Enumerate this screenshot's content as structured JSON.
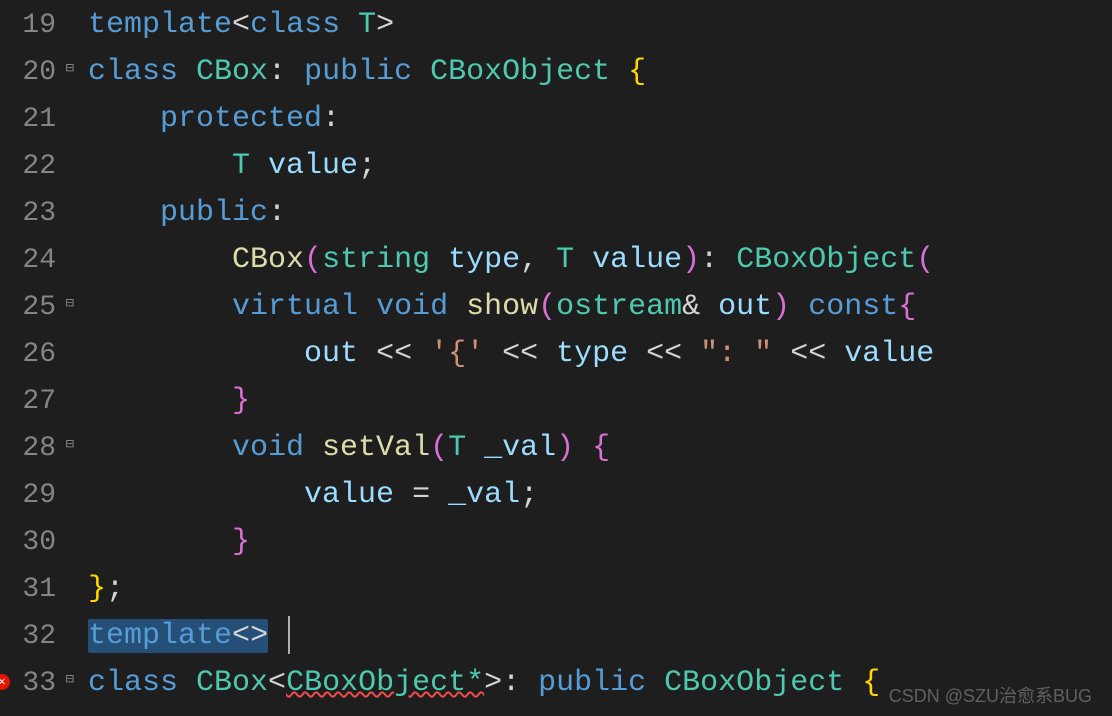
{
  "gutter": {
    "start": 19,
    "end": 33,
    "fold_lines": [
      20,
      25,
      28,
      33
    ],
    "error_lines": [
      33
    ]
  },
  "code": {
    "l19": {
      "template": "template",
      "lt": "<",
      "class": "class",
      "T": " T",
      "gt": ">"
    },
    "l20": {
      "class": "class",
      "CBox": " CBox",
      "colon": ": ",
      "public": "public",
      "CBoxObject": " CBoxObject ",
      "brace": "{"
    },
    "l21": {
      "protected": "protected",
      "colon": ":"
    },
    "l22": {
      "T": "T ",
      "value": "value",
      "semi": ";"
    },
    "l23": {
      "public": "public",
      "colon": ":"
    },
    "l24": {
      "CBox": "CBox",
      "lp": "(",
      "string": "string ",
      "type": "type",
      "c1": ", ",
      "T": "T ",
      "value": "value",
      "rp": ")",
      "colon": ": ",
      "CBoxObject": "CBoxObject",
      "lp2": "("
    },
    "l25": {
      "virtual": "virtual",
      "void": " void",
      "show": " show",
      "lp": "(",
      "ostream": "ostream",
      "amp": "& ",
      "out": "out",
      "rp": ") ",
      "const": "const",
      "brace": "{"
    },
    "l26": {
      "out": "out ",
      "lt1": "<< ",
      "ch1": "'{'",
      " s1": " ",
      "lt2": "<< ",
      "type": "type ",
      "lt3": "<< ",
      "str": "\": \"",
      " s2": " ",
      "lt4": "<< ",
      "value": "value"
    },
    "l27": {
      "brace": "}"
    },
    "l28": {
      "void": "void",
      "setVal": " setVal",
      "lp": "(",
      "T": "T ",
      "val": "_val",
      "rp": ") ",
      "brace": "{"
    },
    "l29": {
      "value": "value ",
      "eq": "= ",
      "val": "_val",
      "semi": ";"
    },
    "l30": {
      "brace": "}"
    },
    "l31": {
      "brace": "}",
      "semi": ";"
    },
    "l32": {
      "template": "template",
      "lt": "<",
      "gt": ">"
    },
    "l33": {
      "class": "class",
      "CBox": " CBox",
      "lt": "<",
      "CBoxObjectP": "CBoxObject*",
      "gt": ">",
      "colon": ": ",
      "public": "public",
      "CBoxObject": " CBoxObject ",
      "brace": "{"
    }
  },
  "watermark": "CSDN @SZU治愈系BUG"
}
